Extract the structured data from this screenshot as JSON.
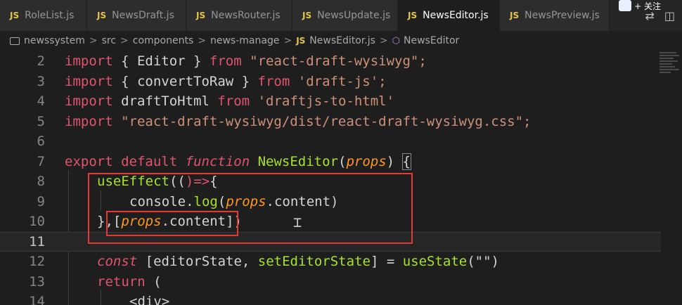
{
  "tabs": [
    {
      "icon": "JS",
      "label": "RoleList.js",
      "active": false
    },
    {
      "icon": "JS",
      "label": "NewsDraft.js",
      "active": false
    },
    {
      "icon": "JS",
      "label": "NewsRouter.js",
      "active": false
    },
    {
      "icon": "JS",
      "label": "NewsUpdate.js",
      "active": false
    },
    {
      "icon": "JS",
      "label": "NewsEditor.js",
      "active": true,
      "modified": true
    },
    {
      "icon": "JS",
      "label": "NewsPreview.js",
      "active": false
    }
  ],
  "follow_badge": "+ 关注",
  "breadcrumb": {
    "items": [
      "newssystem",
      "src",
      "components",
      "news-manage"
    ],
    "file": {
      "icon": "JS",
      "label": "NewsEditor.js"
    },
    "symbol": "NewsEditor",
    "separator": ">"
  },
  "editor": {
    "line_numbers": [
      "2",
      "3",
      "4",
      "5",
      "6",
      "7",
      "8",
      "9",
      "10",
      "11",
      "12",
      "13",
      "14"
    ],
    "current_line": "11",
    "lines": {
      "l2": [
        "import",
        " { Editor } ",
        "from",
        " \"react-draft-wysiwyg\";"
      ],
      "l3": [
        "import",
        " { convertToRaw } ",
        "from",
        " 'draft-js';"
      ],
      "l4": [
        "import",
        " draftToHtml ",
        "from",
        " 'draftjs-to-html'"
      ],
      "l5": [
        "import",
        " \"react-draft-wysiwyg/dist/react-draft-wysiwyg.css\";"
      ],
      "l7": [
        "export",
        " ",
        "default",
        " ",
        "function",
        " ",
        "NewsEditor",
        "(",
        "props",
        ") ",
        "{"
      ],
      "l8": [
        "useEffect",
        "((",
        ")=>",
        "{"
      ],
      "l9": [
        "console",
        ".",
        "log",
        "(",
        "props",
        ".content)"
      ],
      "l10": [
        "}",
        ",",
        "[",
        "props",
        ".content",
        "]",
        ")"
      ],
      "l12": [
        "const",
        " [editorState, ",
        "setEditorState",
        "] = ",
        "useState",
        "(\"\")"
      ],
      "l13": [
        "return",
        " ("
      ],
      "l14": [
        "<div>"
      ]
    }
  },
  "colors": {
    "accent_red_box": "#e53935",
    "background": "#1e1e1e"
  }
}
